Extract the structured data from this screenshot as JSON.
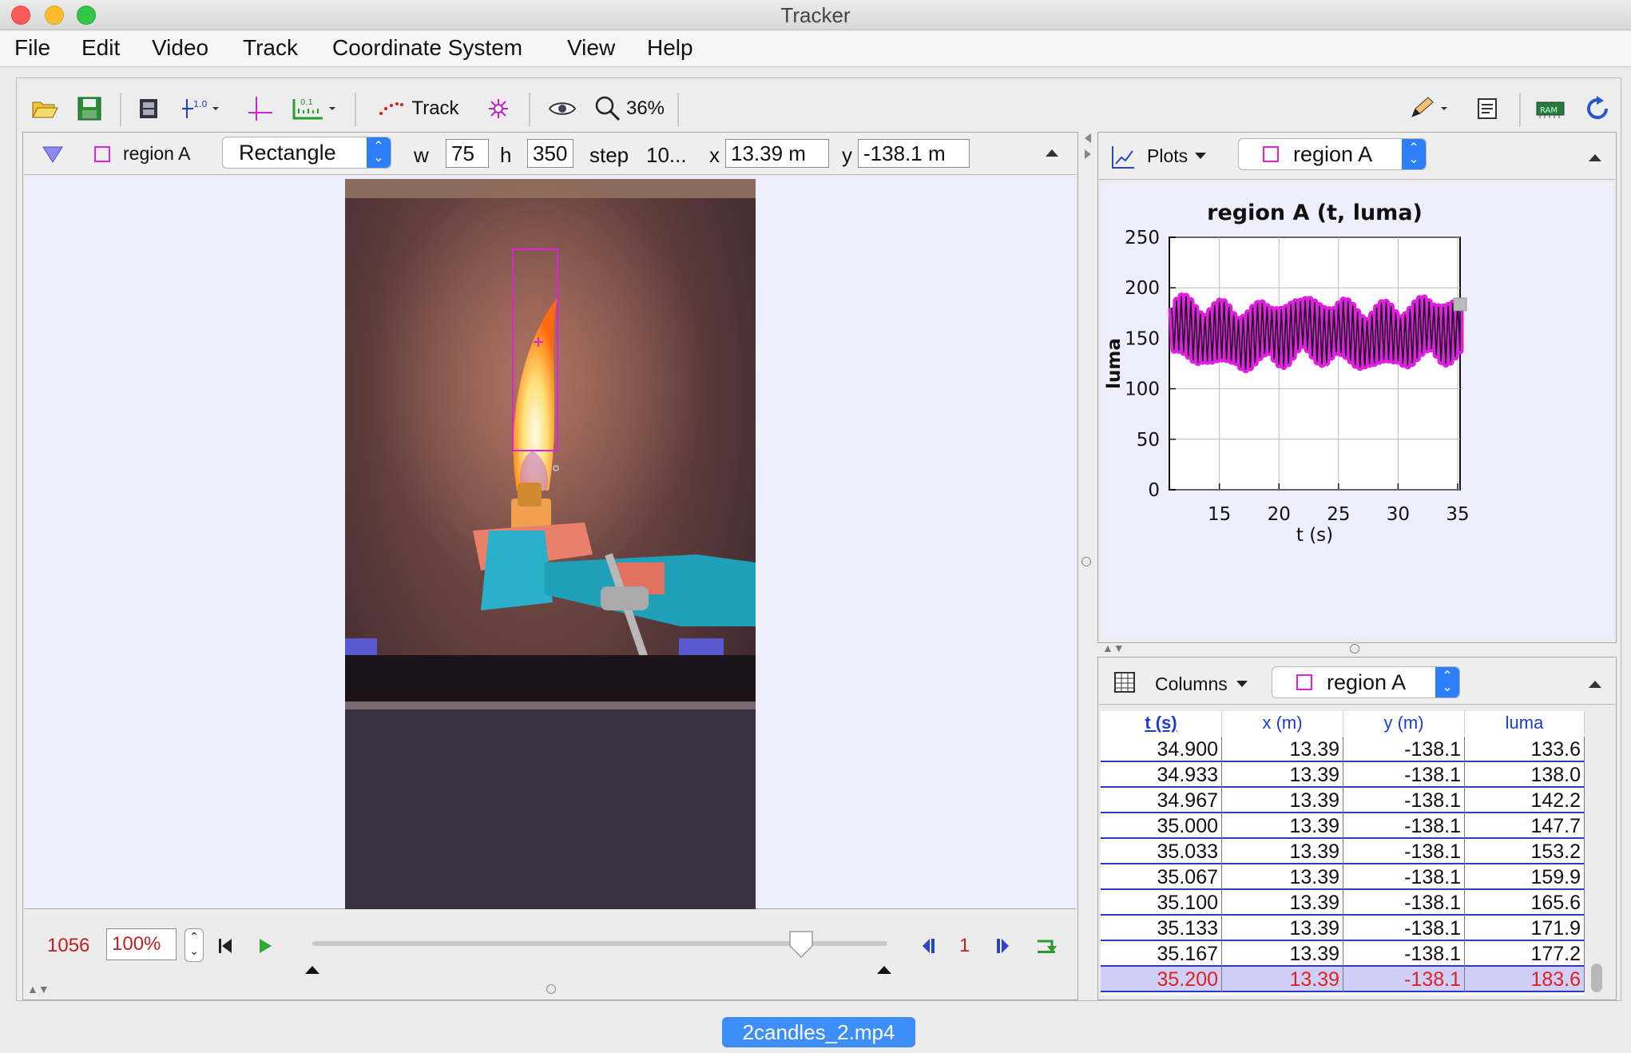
{
  "window": {
    "title": "Tracker",
    "colors": {
      "close": "#fc5b57",
      "minimize": "#fdbc2e",
      "zoom": "#33c748"
    }
  },
  "menu": [
    "File",
    "Edit",
    "Video",
    "Track",
    "Coordinate System",
    "View",
    "Help"
  ],
  "toolbar": {
    "track_label": "Track",
    "zoom": "36%",
    "icons": [
      "open-folder-icon",
      "save-icon",
      "video-clip-icon",
      "calibration-icon",
      "axes-icon",
      "tape-measure-icon",
      "track-points-icon",
      "autotracker-icon",
      "eye-icon",
      "magnifier-icon",
      "pencil-icon",
      "notes-icon",
      "ram-icon",
      "refresh-icon"
    ]
  },
  "track_bar": {
    "track_name": "region A",
    "shape": "Rectangle",
    "w_label": "w",
    "w_value": "75",
    "h_label": "h",
    "h_value": "350",
    "step_label": "step",
    "step_value": "10...",
    "x_label": "x",
    "x_value": "13.39 m",
    "y_label": "y",
    "y_value": "-138.1 m",
    "track_color": "#e020e0"
  },
  "player": {
    "frame_count": "1056",
    "rate": "100%",
    "step_number": "1",
    "slider_position": 0.85
  },
  "plot_panel": {
    "menu_label": "Plots",
    "track_name": "region A"
  },
  "chart_data": {
    "type": "line",
    "title": "region A (t, luma)",
    "xlabel": "t (s)",
    "ylabel": "luma",
    "xlim": [
      10.8,
      35.2
    ],
    "ylim": [
      0,
      250
    ],
    "xticks": [
      15,
      20,
      25,
      30,
      35
    ],
    "yticks": [
      0,
      50,
      100,
      150,
      200,
      250
    ],
    "grid": true,
    "series": [
      {
        "color": "#e020e0",
        "oscillation_period_s": 0.4,
        "center_value": 155,
        "amplitude": 25,
        "x_start": 11.0,
        "x_end": 35.2,
        "final_point": {
          "t": 35.2,
          "luma": 183.6
        }
      }
    ]
  },
  "table_panel": {
    "menu_label": "Columns",
    "track_name": "region A",
    "headers": [
      "t (s)",
      "x (m)",
      "y (m)",
      "luma"
    ],
    "rows": [
      [
        "34.900",
        "13.39",
        "-138.1",
        "133.6"
      ],
      [
        "34.933",
        "13.39",
        "-138.1",
        "138.0"
      ],
      [
        "34.967",
        "13.39",
        "-138.1",
        "142.2"
      ],
      [
        "35.000",
        "13.39",
        "-138.1",
        "147.7"
      ],
      [
        "35.033",
        "13.39",
        "-138.1",
        "153.2"
      ],
      [
        "35.067",
        "13.39",
        "-138.1",
        "159.9"
      ],
      [
        "35.100",
        "13.39",
        "-138.1",
        "165.6"
      ],
      [
        "35.133",
        "13.39",
        "-138.1",
        "171.9"
      ],
      [
        "35.167",
        "13.39",
        "-138.1",
        "177.2"
      ],
      [
        "35.200",
        "13.39",
        "-138.1",
        "183.6"
      ]
    ],
    "selected_row": 9
  },
  "file_tab": "2candles_2.mp4"
}
